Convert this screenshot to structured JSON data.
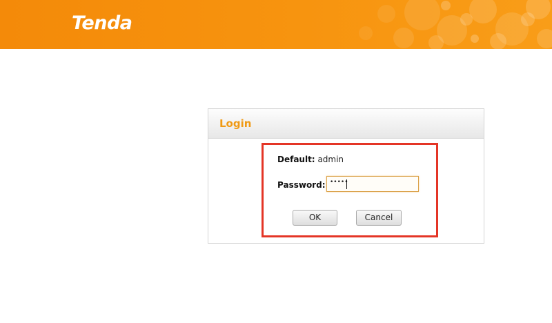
{
  "header": {
    "logo_text": "Tenda"
  },
  "login": {
    "title": "Login",
    "default_label": "Default:",
    "default_value": "admin",
    "password_label": "Password:",
    "password_value": "•••••",
    "ok_label": "OK",
    "cancel_label": "Cancel"
  },
  "colors": {
    "header_orange": "#f7940f",
    "title_orange": "#f09a14",
    "highlight_red": "#e43526"
  }
}
